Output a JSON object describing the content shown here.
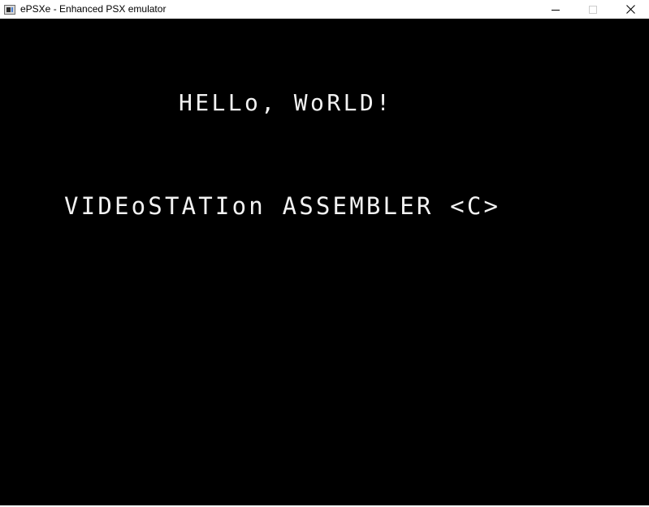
{
  "window": {
    "title": "ePSXe - Enhanced PSX emulator",
    "icon": "epsxe-app-icon",
    "controls": {
      "minimize_icon": "minimize-icon",
      "maximize_icon": "maximize-icon",
      "close_icon": "close-icon"
    }
  },
  "screen": {
    "background": "#000000",
    "text_color": "#f2f2f2",
    "lines": [
      "HELLo, WoRLD!",
      "VIDEoSTATIon ASSEMBLER <C>"
    ]
  }
}
